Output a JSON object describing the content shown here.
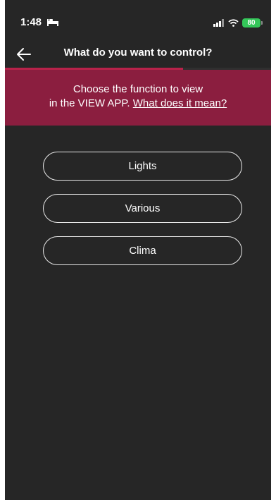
{
  "status_bar": {
    "time": "1:48",
    "battery": "80",
    "icons": [
      "bed-icon",
      "signal-icon",
      "wifi-icon",
      "battery-icon"
    ]
  },
  "header": {
    "title": "What do you want to control?",
    "back_icon": "arrow-left-icon",
    "progress": 0.67
  },
  "banner": {
    "line1": "Choose the function to view",
    "line2_prefix": "in the VIEW APP. ",
    "link": "What does it mean?"
  },
  "options": [
    {
      "label": "Lights"
    },
    {
      "label": "Various"
    },
    {
      "label": "Clima"
    }
  ],
  "colors": {
    "background": "#262626",
    "banner": "#8b1e3f",
    "accent": "#b8224a",
    "battery": "#34c759"
  }
}
